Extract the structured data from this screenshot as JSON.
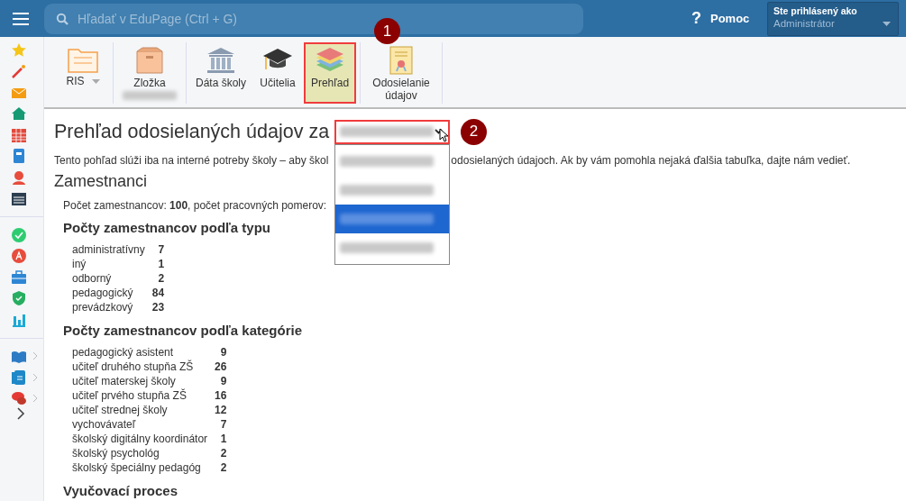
{
  "topbar": {
    "search_placeholder": "Hľadať v EduPage (Ctrl + G)",
    "help_icon": "?",
    "help": "Pomoc",
    "user_caption": "Ste prihlásený ako",
    "user_role": "Administrátor"
  },
  "toolbar": {
    "items": [
      {
        "label": "RIS",
        "has_caret": true,
        "selected": false,
        "redacted_sub": false
      },
      {
        "label": "Zložka",
        "has_caret": false,
        "selected": false,
        "redacted_sub": true
      },
      {
        "label": "Dáta školy",
        "has_caret": false,
        "selected": false,
        "redacted_sub": false
      },
      {
        "label": "Učitelia",
        "has_caret": false,
        "selected": false,
        "redacted_sub": false
      },
      {
        "label": "Prehľad",
        "has_caret": false,
        "selected": true,
        "redacted_sub": false
      },
      {
        "label": "Odosielanie údajov",
        "has_caret": false,
        "selected": false,
        "redacted_sub": false
      }
    ],
    "step_badge": "1"
  },
  "page": {
    "title": "Prehľad odosielaných údajov za",
    "step_badge": "2",
    "dropdown_options": [
      {
        "selected": false
      },
      {
        "selected": false
      },
      {
        "selected": true
      },
      {
        "selected": false
      }
    ],
    "note_before": "Tento pohľad slúži iba na interné potreby školy – aby škol",
    "note_after": "odosielaných údajoch. Ak by vám pomohla nejaká ďalšia tabuľka, dajte nám vedieť.",
    "section": "Zamestnanci",
    "summary": "Počet zamestnancov: **100**, počet pracovných pomerov:",
    "groups": [
      {
        "heading": "Počty zamestnancov podľa typu",
        "rows": [
          {
            "label": "administratívny",
            "value": "7"
          },
          {
            "label": "iný",
            "value": "1"
          },
          {
            "label": "odborný",
            "value": "2"
          },
          {
            "label": "pedagogický",
            "value": "84"
          },
          {
            "label": "prevádzkový",
            "value": "23"
          }
        ]
      },
      {
        "heading": "Počty zamestnancov podľa kategórie",
        "rows": [
          {
            "label": "pedagogický asistent",
            "value": "9"
          },
          {
            "label": "učiteľ druhého stupňa ZŠ",
            "value": "26"
          },
          {
            "label": "učiteľ materskej školy",
            "value": "9"
          },
          {
            "label": "učiteľ prvého stupňa ZŠ",
            "value": "16"
          },
          {
            "label": "učiteľ strednej školy",
            "value": "12"
          },
          {
            "label": "vychovávateľ",
            "value": "7"
          },
          {
            "label": "školský digitálny koordinátor",
            "value": "1"
          },
          {
            "label": "školský psychológ",
            "value": "2"
          },
          {
            "label": "školský špeciálny pedagóg",
            "value": "2"
          }
        ]
      },
      {
        "heading": "Vyučovací proces"
      }
    ]
  }
}
